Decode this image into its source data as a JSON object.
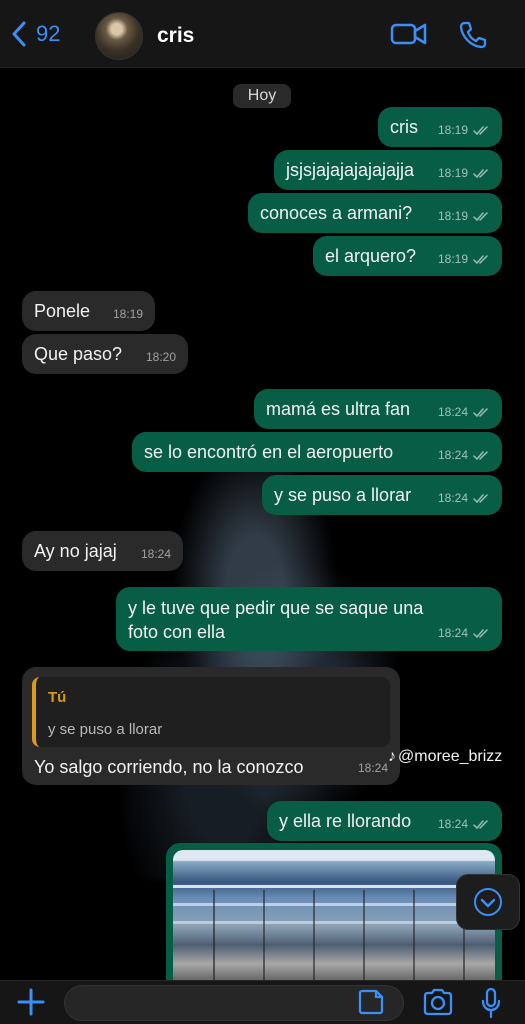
{
  "header": {
    "back_count": "92",
    "contact_name": "cris"
  },
  "date_label": "Hoy",
  "messages": [
    {
      "text": "cris",
      "time": "18:19"
    },
    {
      "text": "jsjsjajajajajajajja",
      "time": "18:19"
    },
    {
      "text": "conoces a armani?",
      "time": "18:19"
    },
    {
      "text": "el arquero?",
      "time": "18:19"
    },
    {
      "text": "Ponele",
      "time": "18:19"
    },
    {
      "text": "Que paso?",
      "time": "18:20"
    },
    {
      "text": "mamá es ultra fan",
      "time": "18:24"
    },
    {
      "text": "se lo encontró en el aeropuerto",
      "time": "18:24"
    },
    {
      "text": "y se puso a llorar",
      "time": "18:24"
    },
    {
      "text": "Ay no jajaj",
      "time": "18:24"
    },
    {
      "text": "y le tuve que pedir que se saque una foto con ella",
      "time": "18:24"
    },
    {
      "text": "Yo salgo corriendo, no la conozco",
      "time": "18:24",
      "reply_author": "Tú",
      "reply_text": "y se puso a llorar"
    },
    {
      "text": "y ella re llorando",
      "time": "18:24"
    }
  ],
  "watermark": {
    "logo": "♪",
    "handle": "@moree_brizz"
  },
  "input": {
    "placeholder": ""
  },
  "colors": {
    "outgoing_bubble": "#075e45",
    "incoming_bubble": "#2a2a2a",
    "accent_blue": "#3b8ff5",
    "reply_accent": "#d99a1d"
  },
  "icons": {
    "back": "chevron-left-icon",
    "video_call": "video-camera-icon",
    "voice_call": "phone-icon",
    "scroll_down": "chevron-down-icon",
    "attach": "plus-icon",
    "sticker": "sticker-icon",
    "camera": "camera-icon",
    "microphone": "microphone-icon",
    "read_receipts": "double-check-icon"
  }
}
